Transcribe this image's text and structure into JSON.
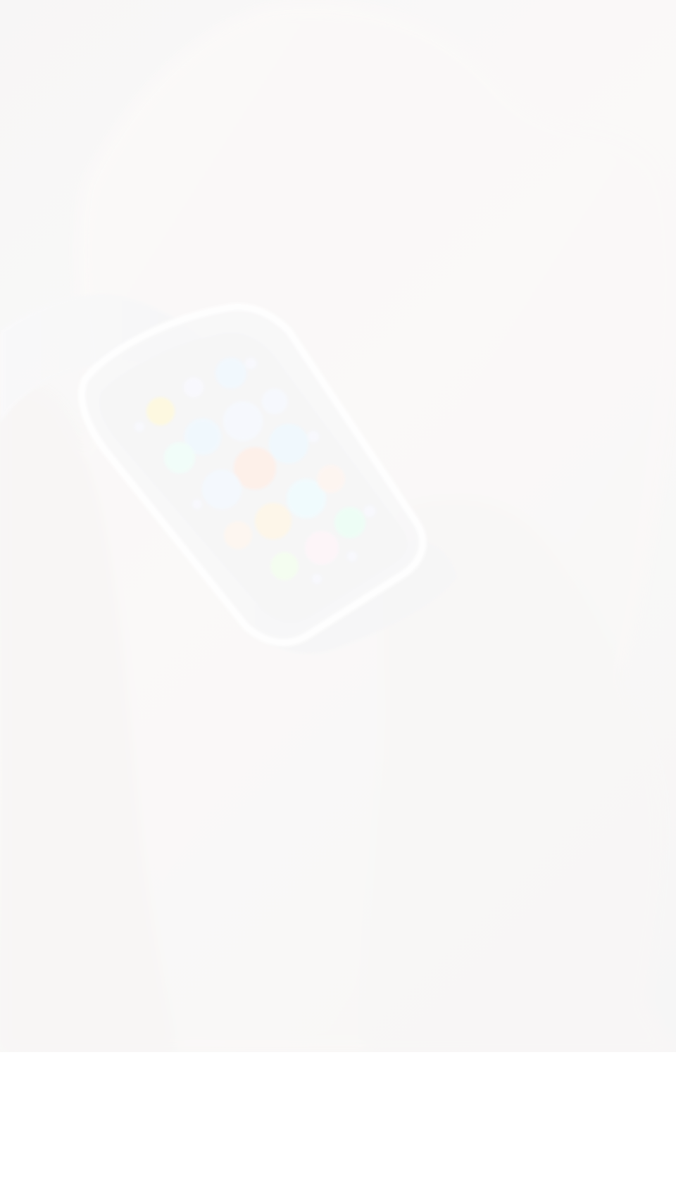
{
  "hero": {
    "image_subject": "faded-photo-hand-wearing-smartwatch",
    "overlay_color": "#ffffff",
    "overlay_opacity": 0.82,
    "app_icon_colors": [
      "#fff6c8",
      "#d8f3ff",
      "#ffe6d9",
      "#e2fff0",
      "#e9f5ff",
      "#fff0f6"
    ]
  }
}
